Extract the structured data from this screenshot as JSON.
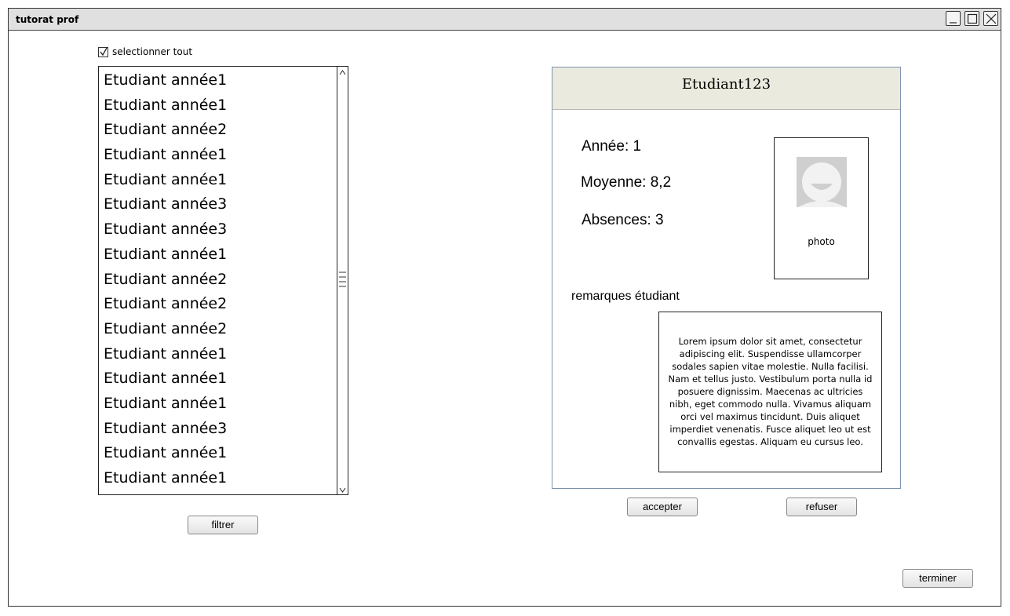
{
  "window": {
    "title": "tutorat prof"
  },
  "select_all": {
    "label": "selectionner tout",
    "checked": true
  },
  "student_list": {
    "items": [
      "Etudiant année1",
      "Etudiant année1",
      "Etudiant année2",
      "Etudiant année1",
      "Etudiant année1",
      "Etudiant année3",
      "Etudiant année3",
      "Etudiant année1",
      "Etudiant année2",
      "Etudiant année2",
      "Etudiant année2",
      "Etudiant année1",
      "Etudiant année1",
      "Etudiant année1",
      "Etudiant année3",
      "Etudiant année1",
      "Etudiant année1"
    ]
  },
  "filter_button": "filtrer",
  "detail": {
    "name": "Etudiant123",
    "year": "Année: 1",
    "average": "Moyenne: 8,2",
    "absences": "Absences: 3",
    "photo_label": "photo",
    "remarks_label": "remarques étudiant",
    "remarks_text": "Lorem ipsum dolor sit amet, consectetur adipiscing elit. Suspendisse ullamcorper sodales sapien vitae molestie. Nulla facilisi. Nam et tellus justo. Vestibulum porta nulla id posuere dignissim. Maecenas ac ultricies nibh, eget commodo nulla. Vivamus aliquam orci vel maximus tincidunt. Duis aliquet imperdiet venenatis. Fusce aliquet leo ut est convallis egestas. Aliquam eu cursus leo."
  },
  "actions": {
    "accept": "accepter",
    "refuse": "refuser",
    "finish": "terminer"
  }
}
